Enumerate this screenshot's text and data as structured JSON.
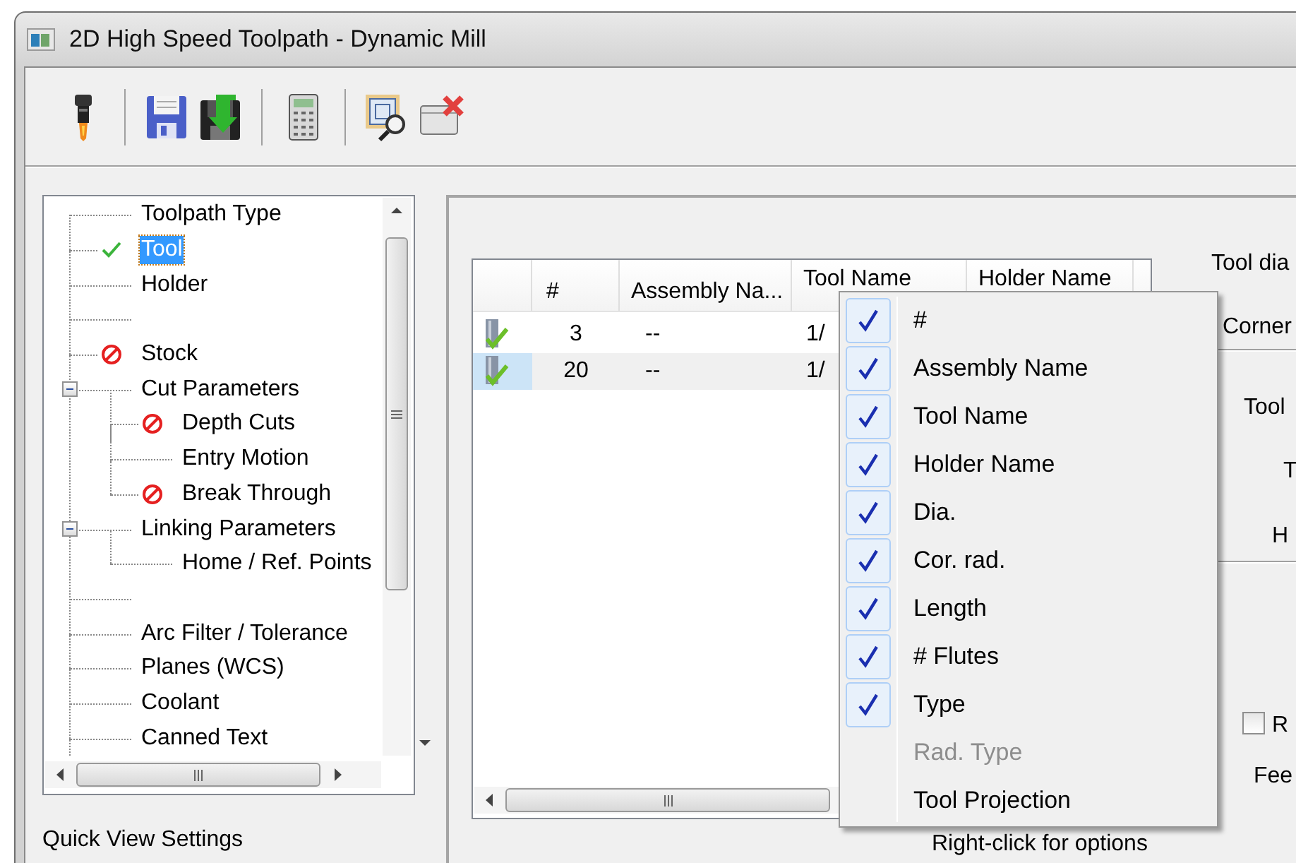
{
  "window": {
    "title": "2D High Speed Toolpath - Dynamic Mill"
  },
  "tree": {
    "items": [
      {
        "kind": "page",
        "label": "Toolpath Type",
        "complete": false,
        "error": false,
        "selected": false
      },
      {
        "kind": "page",
        "label": "Tool",
        "complete": true,
        "error": false,
        "selected": true
      },
      {
        "kind": "page",
        "label": "Holder",
        "complete": false,
        "error": false,
        "selected": false
      },
      {
        "kind": "blank"
      },
      {
        "kind": "page",
        "label": "Stock",
        "complete": false,
        "error": true,
        "selected": false
      },
      {
        "kind": "page",
        "label": "Cut Parameters",
        "complete": false,
        "error": false,
        "selected": false,
        "expanded": true,
        "children": [
          {
            "kind": "page",
            "label": "Depth Cuts",
            "complete": false,
            "error": true,
            "selected": false
          },
          {
            "kind": "page",
            "label": "Entry Motion",
            "complete": false,
            "error": false,
            "selected": false
          },
          {
            "kind": "page",
            "label": "Break Through",
            "complete": false,
            "error": true,
            "selected": false
          }
        ]
      },
      {
        "kind": "page",
        "label": "Linking Parameters",
        "complete": false,
        "error": false,
        "selected": false,
        "expanded": true,
        "children": [
          {
            "kind": "page",
            "label": "Home / Ref. Points",
            "complete": false,
            "error": false,
            "selected": false
          }
        ]
      },
      {
        "kind": "blank"
      },
      {
        "kind": "page",
        "label": "Arc Filter / Tolerance",
        "complete": false,
        "error": false,
        "selected": false
      },
      {
        "kind": "page",
        "label": "Planes (WCS)",
        "complete": false,
        "error": false,
        "selected": false
      },
      {
        "kind": "page",
        "label": "Coolant",
        "complete": false,
        "error": false,
        "selected": false
      },
      {
        "kind": "page",
        "label": "Canned Text",
        "complete": false,
        "error": false,
        "selected": false
      }
    ]
  },
  "quick_view": {
    "label": "Quick View Settings"
  },
  "tool_table": {
    "columns": [
      "#",
      "Assembly Na...",
      "Tool Name",
      "Holder Name"
    ],
    "rows": [
      {
        "number": "3",
        "assembly": "--",
        "tool_name": "1/",
        "selected": false
      },
      {
        "number": "20",
        "assembly": "--",
        "tool_name": "1/",
        "selected": true
      }
    ],
    "hint": "Right-click for options"
  },
  "tool_info": {
    "labels": [
      "Tool dia",
      "Corner",
      "Tool",
      "T",
      "H"
    ],
    "checkbox": {
      "label": "R",
      "checked": false
    },
    "feed_label": "Fee"
  },
  "context_menu": {
    "items": [
      {
        "label": "#",
        "checked": true,
        "disabled": false
      },
      {
        "label": "Assembly Name",
        "checked": true,
        "disabled": false
      },
      {
        "label": "Tool Name",
        "checked": true,
        "disabled": false
      },
      {
        "label": "Holder Name",
        "checked": true,
        "disabled": false
      },
      {
        "label": "Dia.",
        "checked": true,
        "disabled": false
      },
      {
        "label": "Cor. rad.",
        "checked": true,
        "disabled": false
      },
      {
        "label": "Length",
        "checked": true,
        "disabled": false
      },
      {
        "label": "# Flutes",
        "checked": true,
        "disabled": false
      },
      {
        "label": "Type",
        "checked": true,
        "disabled": false
      },
      {
        "label": "Rad. Type",
        "checked": false,
        "disabled": true
      },
      {
        "label": "Tool Projection",
        "checked": false,
        "disabled": false
      }
    ]
  }
}
